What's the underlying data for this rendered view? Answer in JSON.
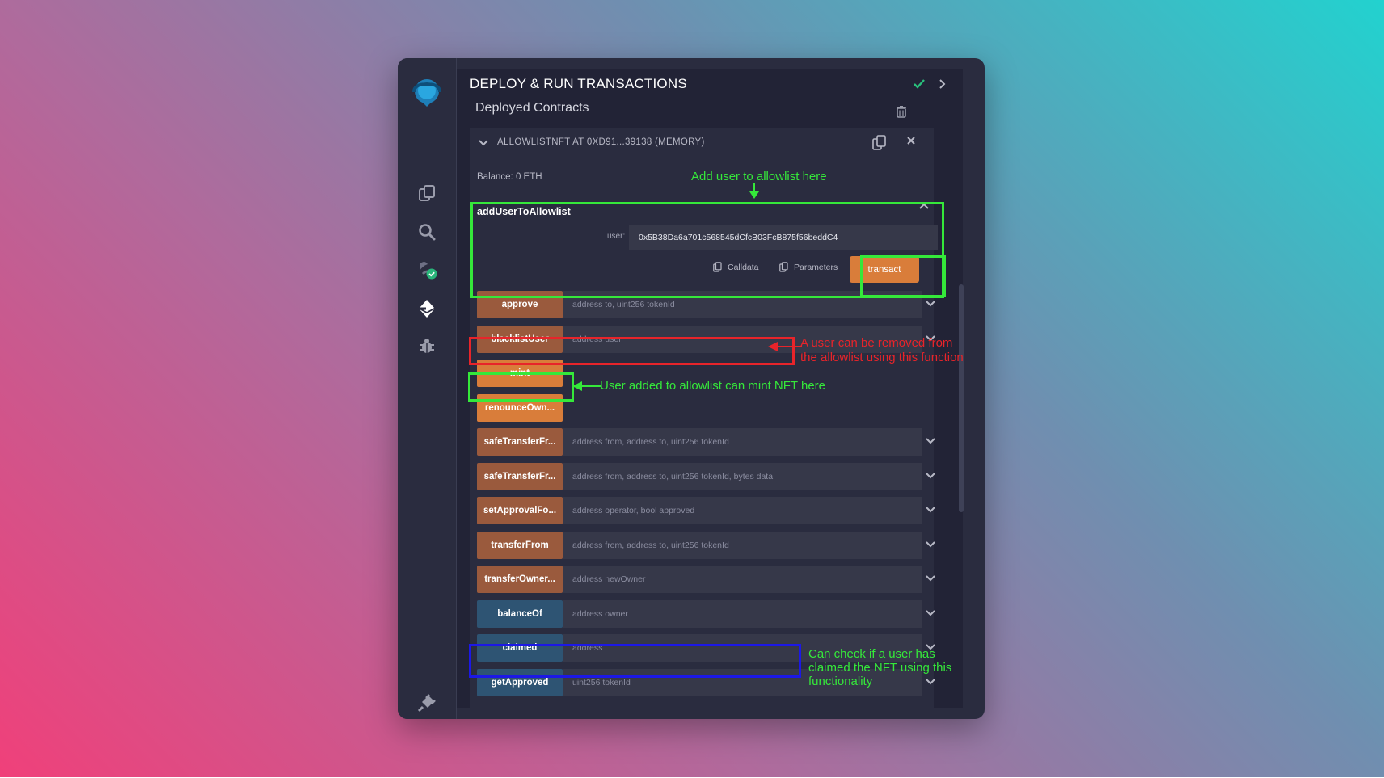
{
  "panel": {
    "title": "DEPLOY & RUN TRANSACTIONS",
    "section_title": "Deployed Contracts"
  },
  "contract": {
    "name": "ALLOWLISTNFT AT 0XD91...39138 (MEMORY)",
    "balance": "Balance: 0 ETH"
  },
  "expanded_function": {
    "name": "addUserToAllowlist",
    "param_label": "user:",
    "param_value": "0x5B38Da6a701c568545dCfcB03FcB875f56beddC4",
    "calldata_label": "Calldata",
    "parameters_label": "Parameters",
    "transact_label": "transact"
  },
  "functions": [
    {
      "name": "approve",
      "params": "address to, uint256 tokenId",
      "kind": "payable"
    },
    {
      "name": "blacklistUser",
      "params": "address user",
      "kind": "payable"
    },
    {
      "name": "mint",
      "params": "",
      "kind": "nonpayable"
    },
    {
      "name": "renounceOwn...",
      "params": "",
      "kind": "nonpayable"
    },
    {
      "name": "safeTransferFr...",
      "params": "address from, address to, uint256 tokenId",
      "kind": "payable"
    },
    {
      "name": "safeTransferFr...",
      "params": "address from, address to, uint256 tokenId, bytes data",
      "kind": "payable"
    },
    {
      "name": "setApprovalFo...",
      "params": "address operator, bool approved",
      "kind": "payable"
    },
    {
      "name": "transferFrom",
      "params": "address from, address to, uint256 tokenId",
      "kind": "payable"
    },
    {
      "name": "transferOwner...",
      "params": "address newOwner",
      "kind": "payable"
    },
    {
      "name": "balanceOf",
      "params": "address owner",
      "kind": "view"
    },
    {
      "name": "claimed",
      "params": "address",
      "kind": "view"
    },
    {
      "name": "getApproved",
      "params": "uint256 tokenId",
      "kind": "view"
    }
  ],
  "annotations": {
    "add_user": "Add user to allowlist here",
    "remove_user_1": "A user can be removed from",
    "remove_user_2": "the allowlist using this function",
    "mint_note": "User added to allowlist can mint NFT here",
    "claimed_1": "Can check if a user has",
    "claimed_2": "claimed the NFT using this",
    "claimed_3": "functionality"
  },
  "icons": [
    "remix-logo-icon",
    "file-explorer-icon",
    "search-icon",
    "compiler-icon",
    "deploy-icon",
    "debugger-icon",
    "plugin-manager-icon",
    "settings-icon",
    "check-icon",
    "chevron-right-icon",
    "trash-icon",
    "chevron-down-icon",
    "copy-icon",
    "close-icon",
    "caret-up-icon"
  ],
  "colors": {
    "payable_button": "#9a5a3d",
    "nonpayable_button": "#d97d3a",
    "view_button": "#2e5473",
    "annotation_green": "#35e83a",
    "annotation_red": "#e8242a",
    "annotation_blue": "#1c18e6"
  }
}
